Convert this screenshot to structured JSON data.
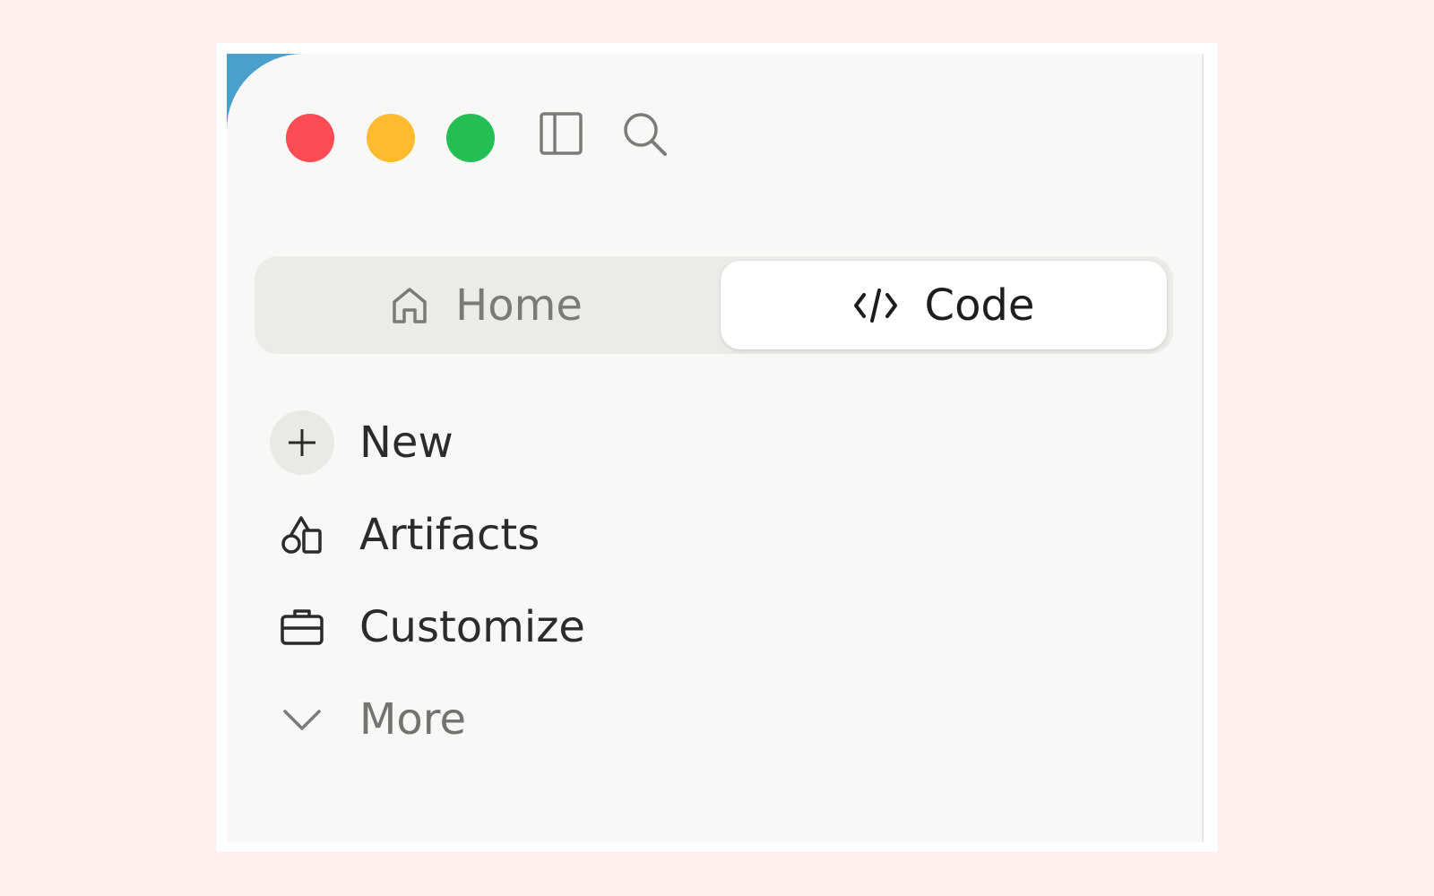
{
  "window": {
    "controls": [
      "close",
      "minimize",
      "maximize"
    ]
  },
  "toolbar": {
    "icons": [
      "sidebar-toggle-icon",
      "search-icon"
    ]
  },
  "mode_switch": {
    "selected": "Code",
    "tabs": [
      {
        "label": "Home",
        "icon": "home-icon"
      },
      {
        "label": "Code",
        "icon": "code-icon"
      }
    ]
  },
  "nav": {
    "items": [
      {
        "label": "New",
        "icon": "plus-icon"
      },
      {
        "label": "Artifacts",
        "icon": "shapes-icon"
      },
      {
        "label": "Customize",
        "icon": "briefcase-icon"
      },
      {
        "label": "More",
        "icon": "chevron-down-icon"
      }
    ]
  },
  "colors": {
    "page_background": "#ffeeea",
    "window_background": "#f8f8f6",
    "close": "#fe4c55",
    "minimize": "#febb2f",
    "maximize": "#23bf55",
    "accent_corner": "#4a9fcb"
  }
}
